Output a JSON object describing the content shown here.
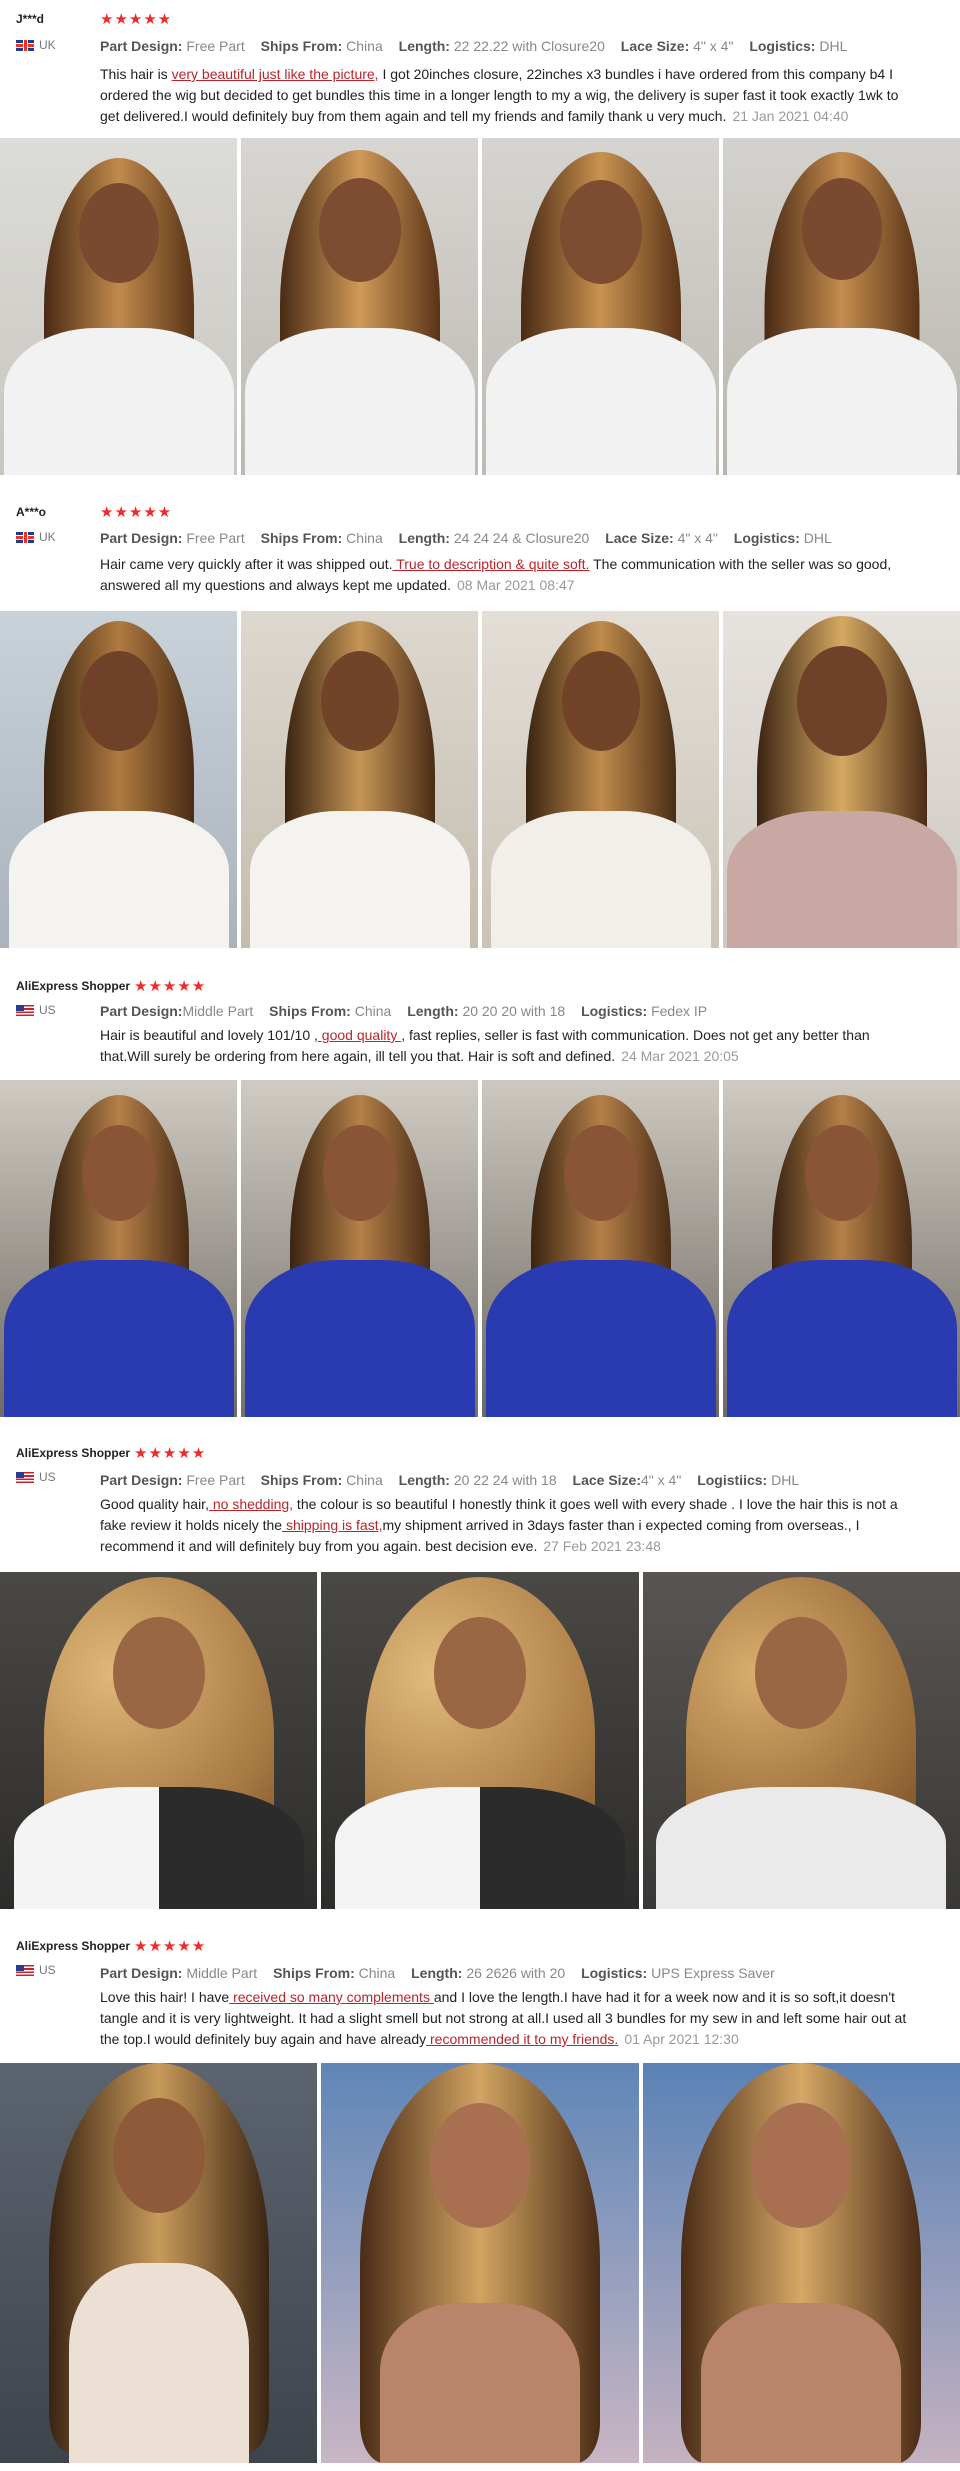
{
  "reviews": [
    {
      "user": "J***d",
      "country": "UK",
      "stars": "★★★★★",
      "spec": {
        "design_label": "Part Design:",
        "design": "Free Part",
        "ships_label": "Ships From:",
        "ships": "China",
        "length_label": "Length:",
        "length": "22 22.22 with Closure20",
        "lace_label": "Lace Size:",
        "lace": "4\" x 4\"",
        "logistics_label": "Logistics:",
        "logistics": "DHL"
      },
      "text_a": "This hair is ",
      "hl_1": "very beautiful just like the picture,",
      "text_b": " I got 20inches closure, 22inches x3 bundles i have ordered from this company b4 I ordered the wig but decided to get bundles this time in a longer length to my a wig, the delivery is super fast it took exactly 1wk to get delivered.I would definitely buy from them again and tell my friends and family thank u very much.",
      "date": "21 Jan 2021 04:40"
    },
    {
      "user": "A***o",
      "country": "UK",
      "stars": "★★★★★",
      "spec": {
        "design_label": "Part Design:",
        "design": "Free Part",
        "ships_label": "Ships From:",
        "ships": "China",
        "length_label": "Length:",
        "length": "24 24 24 & Closure20",
        "lace_label": "Lace Size:",
        "lace": "4\" x 4\"",
        "logistics_label": "Logistics:",
        "logistics": "DHL"
      },
      "text_a": "Hair came very quickly after it was shipped out.",
      "hl_1": " True to description & quite soft.",
      "text_b": " The communication with the seller was so good, answered all my questions and always kept me updated.",
      "date": "08 Mar 2021 08:47"
    },
    {
      "user": "AliExpress Shopper",
      "country": "US",
      "stars": "★★★★★",
      "spec": {
        "design_label": "Part Design:",
        "design": "Middle Part",
        "ships_label": "Ships From:",
        "ships": "China",
        "length_label": "Length:",
        "length": "20 20 20 with 18",
        "logistics_label": "Logistics:",
        "logistics": "Fedex IP"
      },
      "text_a": "Hair is beautiful and lovely 101/10 ,",
      "hl_1": " good quality ",
      "text_b": ", fast replies, seller is fast with communication. Does not get any better than that.Will surely be ordering from here again, ill tell you that. Hair is soft and defined.",
      "date": "24 Mar 2021 20:05"
    },
    {
      "user": "AliExpress Shopper",
      "country": "US",
      "stars": "★★★★★",
      "spec": {
        "design_label": "Part Design:",
        "design": "Free Part",
        "ships_label": "Ships From:",
        "ships": "China",
        "length_label": "Length:",
        "length": "20 22 24 with 18",
        "lace_label": "Lace Size:",
        "lace": "4\" x 4\"",
        "logistics_label": "Logistiics:",
        "logistics": "DHL"
      },
      "text_a": "Good quality hair,",
      "hl_1": " no shedding,",
      "text_b": " the colour is so beautiful I honestly think it goes well with every shade . I love the hair this is not a fake review it holds nicely the",
      "hl_2": " shipping is fast,",
      "text_c": "my shipment arrived in 3days faster than i expected coming from overseas., I recommend it and will definitely buy from you again. best decision eve.",
      "date": "27 Feb 2021 23:48"
    },
    {
      "user": "AliExpress Shopper",
      "country": "US",
      "stars": "★★★★★",
      "spec": {
        "design_label": "Part Design:",
        "design": "Middle Part",
        "ships_label": "Ships From:",
        "ships": "China",
        "length_label": "Length:",
        "length": "26 2626 with 20",
        "logistics_label": "Logistics:",
        "logistics": "UPS Express Saver"
      },
      "text_a": "Love this hair! I have",
      "hl_1": " received so many complements ",
      "text_b": "and I love the length.I have had it for a week now and it is so soft,it doesn't tangle and it is very lightweight. It had a slight smell but not strong at all.I used all 3 bundles for my sew in and left some hair out at the top.I would definitely buy again and have already",
      "hl_2": " recommended it to my friends.",
      "text_c": "",
      "date": "01 Apr 2021 12:30"
    }
  ]
}
